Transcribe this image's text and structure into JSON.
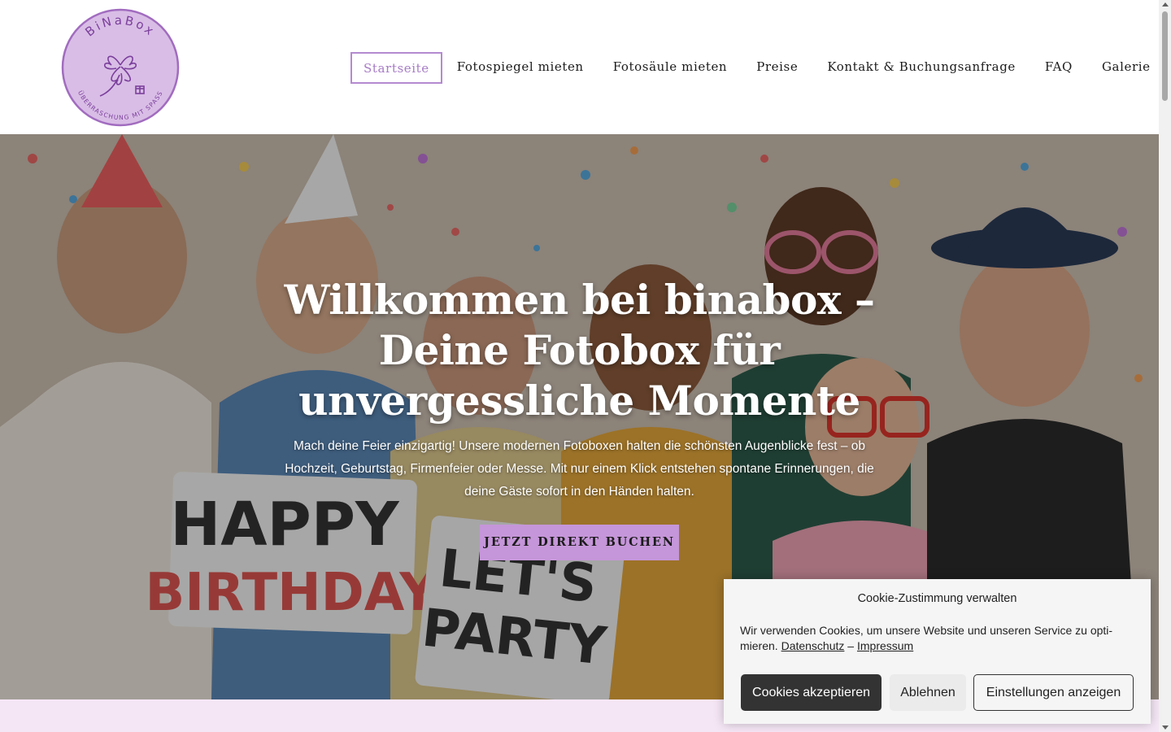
{
  "brand": {
    "logo_text": "BiNaBox",
    "logo_tagline": "ÜBERRASCHUNG MIT SPASS",
    "color": "#a16cbf"
  },
  "nav": {
    "items": [
      {
        "label": "Startseite",
        "active": true
      },
      {
        "label": "Fotospiegel mieten",
        "active": false
      },
      {
        "label": "Fotosäule mieten",
        "active": false
      },
      {
        "label": "Preise",
        "active": false
      },
      {
        "label": "Kontakt & Buchungsanfrage",
        "active": false
      },
      {
        "label": "FAQ",
        "active": false
      },
      {
        "label": "Galerie",
        "active": false
      }
    ]
  },
  "hero": {
    "title": "Willkommen bei binabox – Deine Fotobox für unvergessliche Momente",
    "text": "Mach deine Feier einzigartig! Unsere modernen Fotoboxen halten die schönsten Augenblicke fest – ob Hochzeit, Geburtstag, Firmenfeier oder Messe. Mit nur einem Klick entstehen spontane Erinnerungen, die deine Gäste sofort in den Händen halten.",
    "cta_label": "JETZT DIREKT BUCHEN",
    "cta_color": "#c596d9",
    "sign_1_line_1": "HAPPY",
    "sign_1_line_2": "BIRTHDAY",
    "sign_2_line_1": "LET'S",
    "sign_2_line_2": "PARTY"
  },
  "cookie": {
    "title": "Cookie-Zustimmung verwalten",
    "text": "Wir verwenden Cookies, um unsere Website und unseren Service zu opti­mieren.",
    "privacy_link": "Datenschutz",
    "separator": "–",
    "imprint_link": "Impressum",
    "accept_label": "Cookies akzeptieren",
    "deny_label": "Ablehnen",
    "settings_label": "Einstellungen anzeigen"
  }
}
